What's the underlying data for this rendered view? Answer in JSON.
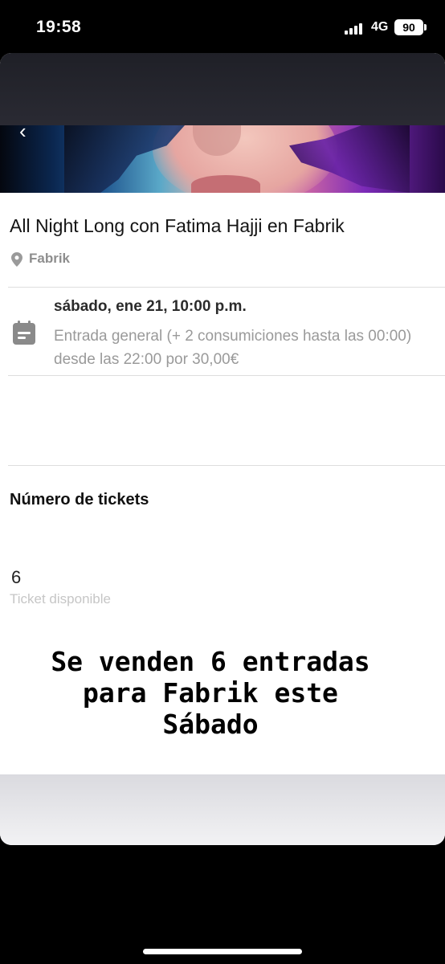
{
  "status_bar": {
    "time": "19:58",
    "network": "4G",
    "battery": "90"
  },
  "event": {
    "title": "All Night Long con Fatima Hajji en Fabrik",
    "location": "Fabrik",
    "date": "sábado, ene 21, 10:00 p.m.",
    "ticket_description": "Entrada general (+ 2 consumiciones hasta las 00:00) desde las 22:00 por 30,00€"
  },
  "tickets": {
    "heading": "Número de tickets",
    "count": "6",
    "available_label": "Ticket disponible"
  },
  "overlay_text": {
    "line1": "Se venden 6 entradas",
    "line2": "para Fabrik este",
    "line3": "Sábado"
  },
  "icons": {
    "pin": "map-pin-icon",
    "calendar": "calendar-icon",
    "back": "chevron-left-icon"
  }
}
